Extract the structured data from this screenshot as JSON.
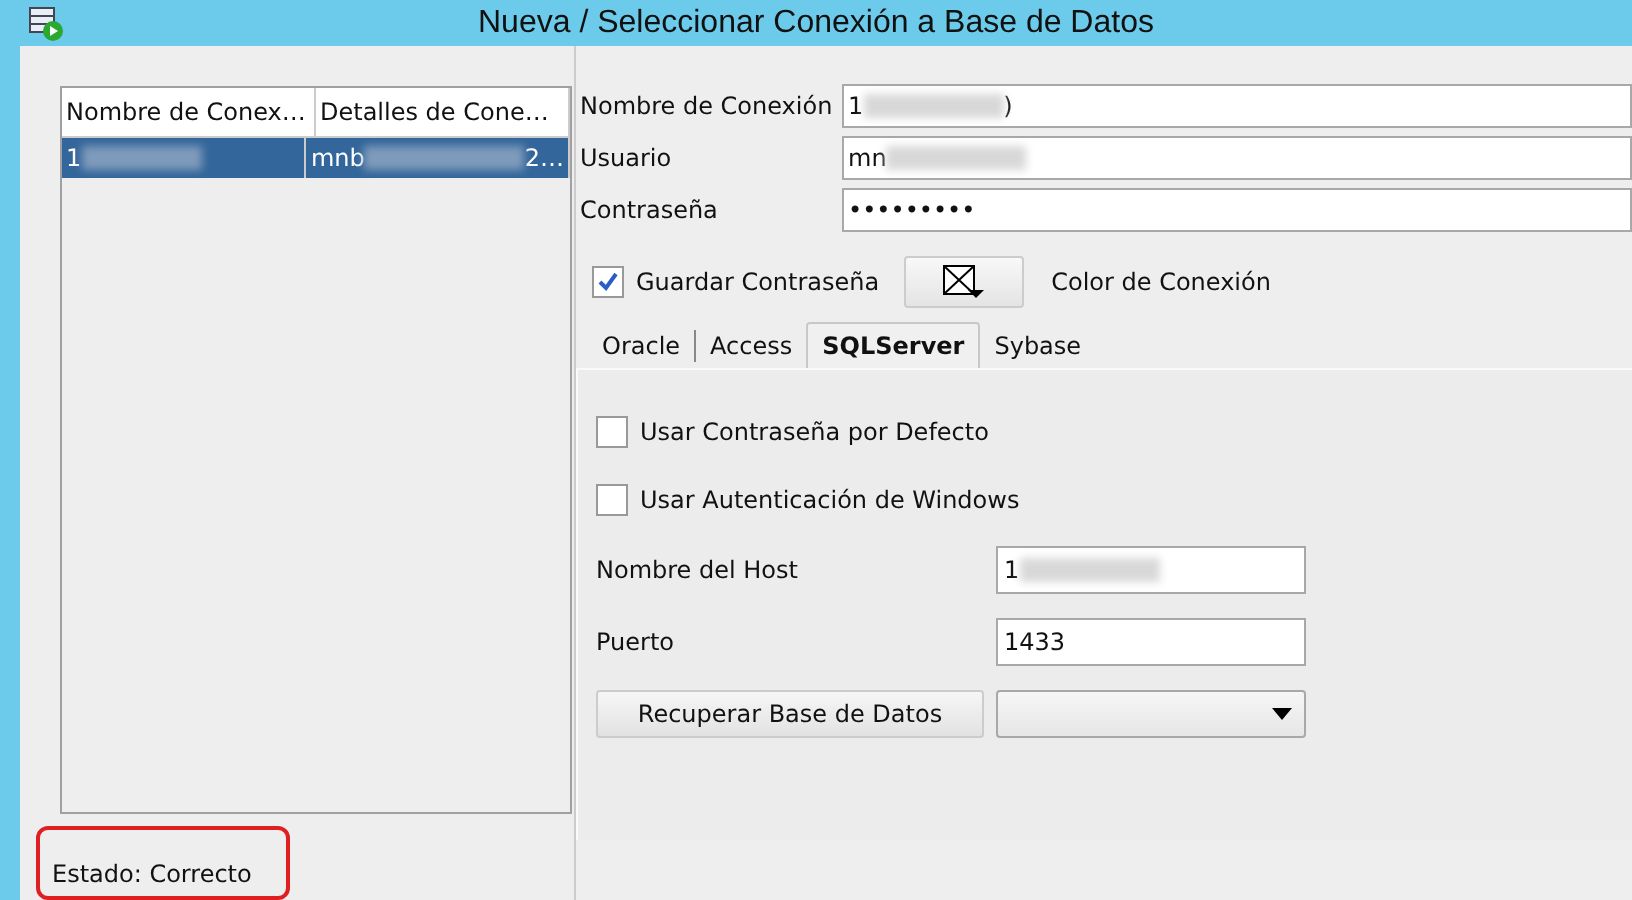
{
  "window": {
    "title": "Nueva / Seleccionar Conexión a Base de Datos"
  },
  "connections": {
    "columns": [
      "Nombre de Conex…",
      "Detalles de Cone…"
    ],
    "rows": [
      {
        "cells": [
          {
            "text": "1",
            "redacted": true
          },
          {
            "text": "mnb",
            "redacted": true,
            "suffix": "2…"
          }
        ],
        "selected": true
      }
    ]
  },
  "form": {
    "fields": [
      {
        "label": "Nombre de Conexión",
        "value": "1",
        "redacted": true,
        "tail": ")"
      },
      {
        "label": "Usuario",
        "value": "mn",
        "redacted": true
      },
      {
        "label": "Contraseña",
        "value": "•••••••••",
        "redacted": false
      }
    ],
    "save_password": {
      "label": "Guardar Contraseña",
      "checked": true
    },
    "color_label": "Color de Conexión"
  },
  "tabs": [
    {
      "label": "Oracle",
      "selected": false
    },
    {
      "label": "Access",
      "selected": false
    },
    {
      "label": "SQLServer",
      "selected": true
    },
    {
      "label": "Sybase",
      "selected": false
    }
  ],
  "sqlserver": {
    "options": [
      {
        "label": "Usar Contraseña por Defecto",
        "checked": false
      },
      {
        "label": "Usar Autenticación de Windows",
        "checked": false
      }
    ],
    "fields": [
      {
        "label": "Nombre del Host",
        "value": "1",
        "redacted": true
      },
      {
        "label": "Puerto",
        "value": "1433",
        "redacted": false
      }
    ],
    "fetch_button": "Recuperar Base de Datos"
  },
  "status": {
    "text": "Estado: Correcto",
    "highlighted": true
  }
}
